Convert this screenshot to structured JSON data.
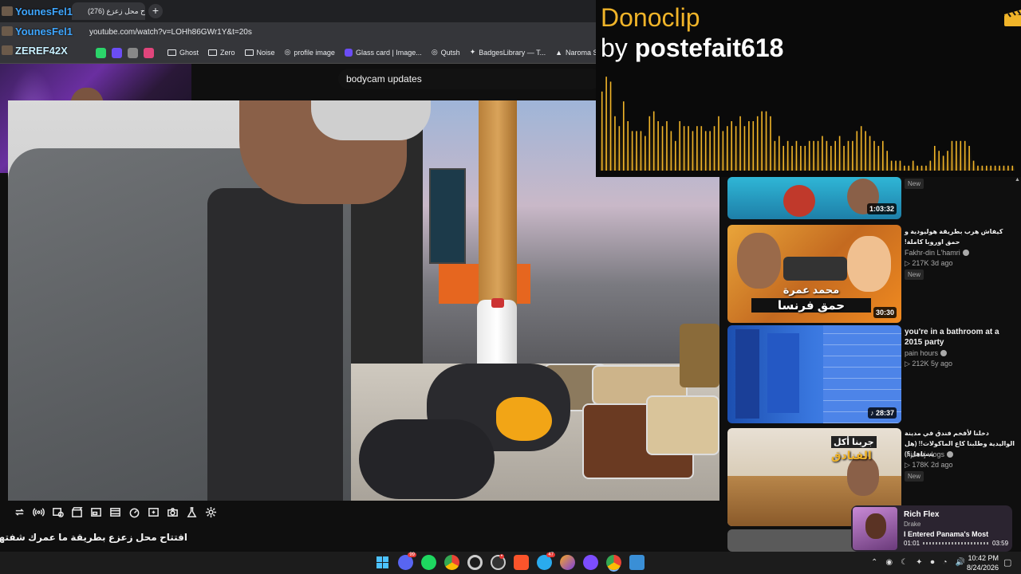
{
  "browser": {
    "tab_title": "(276) افتتاح محل زعزع",
    "url": "youtube.com/watch?v=LOHh86GWr1Y&t=20s",
    "bookmarks": [
      {
        "label": "Ghost",
        "icon": "folder-icon"
      },
      {
        "label": "Zero",
        "icon": "folder-icon"
      },
      {
        "label": "Noise",
        "icon": "folder-icon"
      },
      {
        "label": "profile image",
        "icon": "globe-icon"
      },
      {
        "label": "Glass card | Image...",
        "icon": "site-icon"
      },
      {
        "label": "Qutsh",
        "icon": "globe-icon"
      },
      {
        "label": "BadgesLibrary — T...",
        "icon": "site-icon"
      },
      {
        "label": "Naroma Shop |",
        "icon": "site-icon"
      }
    ]
  },
  "chat": {
    "names": [
      "YounesFel1",
      "YounesFel1",
      "ZEREF42X"
    ]
  },
  "youtube": {
    "search_value": "bodycam updates",
    "video_title": "افتتاح محل زعزع بطريقة ما عمرك شفتها! 🔥 😍"
  },
  "donoclip": {
    "title": "Donoclip",
    "by_prefix": "by",
    "user": "postefait618",
    "accent": "#f0b429",
    "wave_levels": [
      0.8,
      0.95,
      0.9,
      0.55,
      0.45,
      0.7,
      0.5,
      0.4,
      0.4,
      0.4,
      0.35,
      0.55,
      0.6,
      0.5,
      0.45,
      0.5,
      0.4,
      0.3,
      0.5,
      0.45,
      0.45,
      0.4,
      0.45,
      0.45,
      0.4,
      0.4,
      0.45,
      0.55,
      0.4,
      0.45,
      0.5,
      0.45,
      0.55,
      0.45,
      0.5,
      0.5,
      0.55,
      0.6,
      0.6,
      0.55,
      0.3,
      0.35,
      0.25,
      0.3,
      0.25,
      0.3,
      0.25,
      0.25,
      0.3,
      0.3,
      0.3,
      0.35,
      0.3,
      0.25,
      0.3,
      0.35,
      0.25,
      0.3,
      0.3,
      0.4,
      0.45,
      0.4,
      0.35,
      0.3,
      0.25,
      0.3,
      0.2,
      0.1,
      0.1,
      0.1,
      0.05,
      0.05,
      0.1,
      0.05,
      0.05,
      0.05,
      0.1,
      0.25,
      0.2,
      0.15,
      0.2,
      0.3,
      0.3,
      0.3,
      0.3,
      0.25,
      0.1,
      0.05,
      0.05,
      0.05,
      0.05,
      0.05,
      0.05,
      0.05,
      0.05,
      0.05
    ]
  },
  "sidebar": {
    "items": [
      {
        "title": "",
        "channel": "",
        "meta": "",
        "badge": "New",
        "duration": "1:03:32"
      },
      {
        "title": "كيفاش هرب بطريقة هوليودية و حمق اوروبا كاملة!",
        "channel": "Fakhr-din L'hamri",
        "meta": "▷ 217K  3d ago",
        "badge": "New",
        "duration": "30:30",
        "thumb_text_1": "محمد عمرة",
        "thumb_text_2": "حمق فرنسا"
      },
      {
        "title": "you're in a bathroom at a 2015 party",
        "channel": "pain hours",
        "meta": "▷ 212K  5y ago",
        "badge": "",
        "duration": "♪ 28:37"
      },
      {
        "title": "دخلنا لأفخم فندق في مدينة الواليدية وطلبنا كاع الماكولات!! (هل يستاهل؟)",
        "channel": "Ihjaouj vlogs",
        "meta": "▷ 178K  2d ago",
        "badge": "New",
        "duration": "",
        "thumb_text_1": "جربنا أكل",
        "thumb_text_2": "الفنادق"
      }
    ]
  },
  "music": {
    "song": "Rich Flex",
    "artist": "Drake",
    "next": "I Entered Panama's Most",
    "elapsed": "01:01",
    "total": "03:59"
  },
  "taskbar": {
    "time": "10:42 PM",
    "date": "8/24/2026",
    "badges": {
      "discord": "99",
      "telegram": "47"
    }
  }
}
